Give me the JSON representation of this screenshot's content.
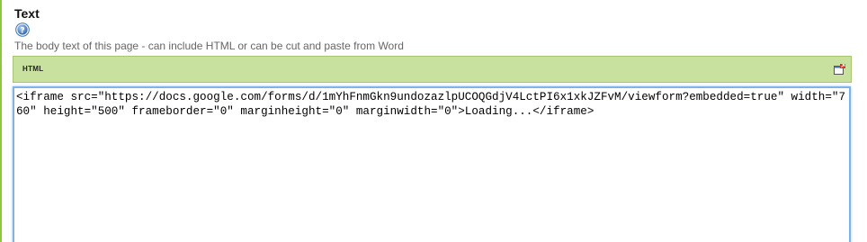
{
  "field": {
    "title": "Text",
    "description": "The body text of this page - can include HTML or can be cut and paste from Word",
    "help_icon": "help-question-icon"
  },
  "toolbar": {
    "html_button_label": "HTML",
    "maximize_icon": "maximize-window-icon"
  },
  "editor": {
    "value": "<iframe src=\"https://docs.google.com/forms/d/1mYhFnmGkn9undozazlpUCOQGdjV4LctPI6x1xkJZFvM/viewform?embedded=true\" width=\"760\" height=\"500\" frameborder=\"0\" marginheight=\"0\" marginwidth=\"0\">Loading...</iframe>"
  },
  "colors": {
    "accent_green": "#8cc63f",
    "toolbar_green": "#c9e19e",
    "focus_blue": "#7fb2e8"
  }
}
